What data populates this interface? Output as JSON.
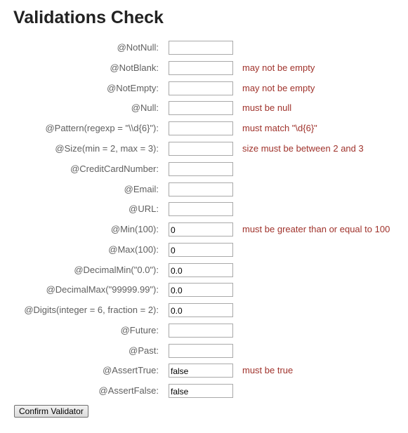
{
  "page": {
    "title": "Validations Check"
  },
  "form": {
    "rows": [
      {
        "label": "@NotNull:",
        "value": "",
        "error": ""
      },
      {
        "label": "@NotBlank:",
        "value": "",
        "error": "may not be empty"
      },
      {
        "label": "@NotEmpty:",
        "value": "",
        "error": "may not be empty"
      },
      {
        "label": "@Null:",
        "value": "",
        "error": "must be null"
      },
      {
        "label": "@Pattern(regexp = \"\\\\d{6}\"):",
        "value": "",
        "error": "must match \"\\d{6}\""
      },
      {
        "label": "@Size(min = 2, max = 3):",
        "value": "",
        "error": "size must be between 2 and 3"
      },
      {
        "label": "@CreditCardNumber:",
        "value": "",
        "error": ""
      },
      {
        "label": "@Email:",
        "value": "",
        "error": ""
      },
      {
        "label": "@URL:",
        "value": "",
        "error": ""
      },
      {
        "label": "@Min(100):",
        "value": "0",
        "error": "must be greater than or equal to 100"
      },
      {
        "label": "@Max(100):",
        "value": "0",
        "error": ""
      },
      {
        "label": "@DecimalMin(\"0.0\"):",
        "value": "0.0",
        "error": ""
      },
      {
        "label": "@DecimalMax(\"99999.99\"):",
        "value": "0.0",
        "error": ""
      },
      {
        "label": "@Digits(integer = 6, fraction = 2):",
        "value": "0.0",
        "error": ""
      },
      {
        "label": "@Future:",
        "value": "",
        "error": ""
      },
      {
        "label": "@Past:",
        "value": "",
        "error": ""
      },
      {
        "label": "@AssertTrue:",
        "value": "false",
        "error": "must be true"
      },
      {
        "label": "@AssertFalse:",
        "value": "false",
        "error": ""
      }
    ],
    "submit_label": "Confirm Validator"
  },
  "colors": {
    "error": "#a0332c",
    "label": "#606060",
    "title": "#222222"
  }
}
